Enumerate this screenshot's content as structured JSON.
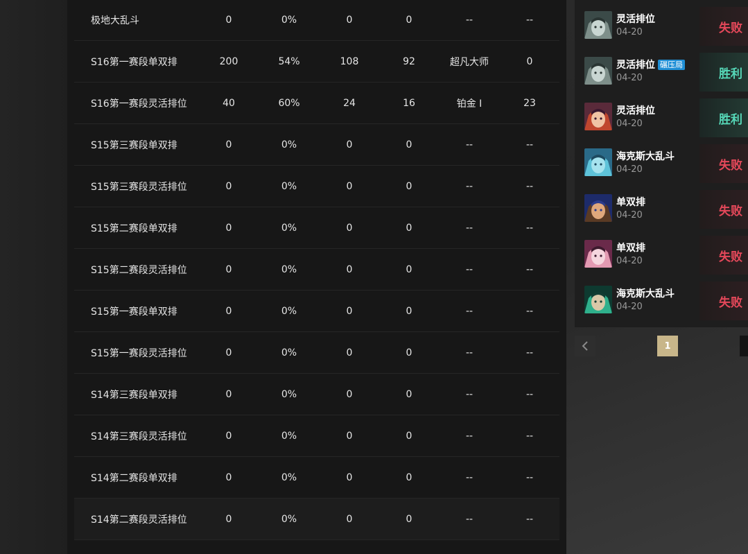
{
  "stats": {
    "rows": [
      {
        "name": "极地大乱斗",
        "total": "0",
        "winrate": "0%",
        "wins": "0",
        "losses": "0",
        "rank": "--",
        "points": "--"
      },
      {
        "name": "S16第一赛段单双排",
        "total": "200",
        "winrate": "54%",
        "wins": "108",
        "losses": "92",
        "rank": "超凡大师",
        "points": "0"
      },
      {
        "name": "S16第一赛段灵活排位",
        "total": "40",
        "winrate": "60%",
        "wins": "24",
        "losses": "16",
        "rank": "铂金 Ⅰ",
        "points": "23"
      },
      {
        "name": "S15第三赛段单双排",
        "total": "0",
        "winrate": "0%",
        "wins": "0",
        "losses": "0",
        "rank": "--",
        "points": "--"
      },
      {
        "name": "S15第三赛段灵活排位",
        "total": "0",
        "winrate": "0%",
        "wins": "0",
        "losses": "0",
        "rank": "--",
        "points": "--"
      },
      {
        "name": "S15第二赛段单双排",
        "total": "0",
        "winrate": "0%",
        "wins": "0",
        "losses": "0",
        "rank": "--",
        "points": "--"
      },
      {
        "name": "S15第二赛段灵活排位",
        "total": "0",
        "winrate": "0%",
        "wins": "0",
        "losses": "0",
        "rank": "--",
        "points": "--"
      },
      {
        "name": "S15第一赛段单双排",
        "total": "0",
        "winrate": "0%",
        "wins": "0",
        "losses": "0",
        "rank": "--",
        "points": "--"
      },
      {
        "name": "S15第一赛段灵活排位",
        "total": "0",
        "winrate": "0%",
        "wins": "0",
        "losses": "0",
        "rank": "--",
        "points": "--"
      },
      {
        "name": "S14第三赛段单双排",
        "total": "0",
        "winrate": "0%",
        "wins": "0",
        "losses": "0",
        "rank": "--",
        "points": "--"
      },
      {
        "name": "S14第三赛段灵活排位",
        "total": "0",
        "winrate": "0%",
        "wins": "0",
        "losses": "0",
        "rank": "--",
        "points": "--"
      },
      {
        "name": "S14第二赛段单双排",
        "total": "0",
        "winrate": "0%",
        "wins": "0",
        "losses": "0",
        "rank": "--",
        "points": "--"
      },
      {
        "name": "S14第二赛段灵活排位",
        "total": "0",
        "winrate": "0%",
        "wins": "0",
        "losses": "0",
        "rank": "--",
        "points": "--"
      }
    ]
  },
  "matches": [
    {
      "mode": "灵活排位",
      "badge": "",
      "date": "04-20",
      "result": "失败",
      "outcome": "loss",
      "avatar_icon": "armored-knight-icon"
    },
    {
      "mode": "灵活排位",
      "badge": "碾压局",
      "date": "04-20",
      "result": "胜利",
      "outcome": "win",
      "avatar_icon": "armored-knight-icon"
    },
    {
      "mode": "灵活排位",
      "badge": "",
      "date": "04-20",
      "result": "胜利",
      "outcome": "win",
      "avatar_icon": "red-haired-mage-icon"
    },
    {
      "mode": "海克斯大乱斗",
      "badge": "",
      "date": "04-20",
      "result": "失败",
      "outcome": "loss",
      "avatar_icon": "fish-creature-icon"
    },
    {
      "mode": "单双排",
      "badge": "",
      "date": "04-20",
      "result": "失败",
      "outcome": "loss",
      "avatar_icon": "brown-haired-fighter-icon"
    },
    {
      "mode": "单双排",
      "badge": "",
      "date": "04-20",
      "result": "失败",
      "outcome": "loss",
      "avatar_icon": "pink-haired-yordle-icon"
    },
    {
      "mode": "海克斯大乱斗",
      "badge": "",
      "date": "04-20",
      "result": "失败",
      "outcome": "loss",
      "avatar_icon": "green-mystic-icon"
    }
  ],
  "pagination": {
    "prev_icon": "chevron-left-icon",
    "current_page": "1"
  },
  "colors": {
    "loss": "#e5485a",
    "win": "#56d8b8",
    "badge": "#1f8fd6",
    "active_page": "#c8b68a"
  }
}
